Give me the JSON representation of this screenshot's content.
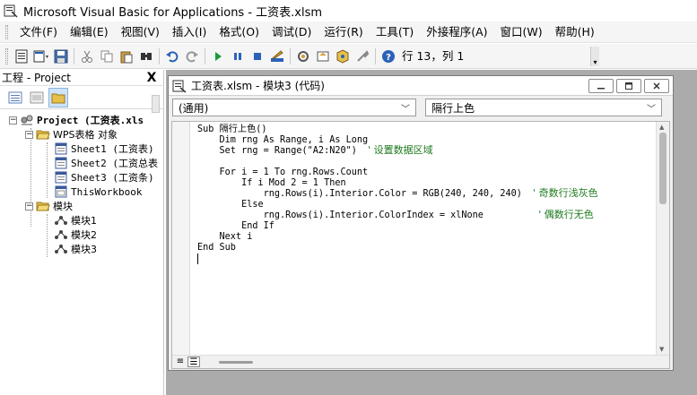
{
  "window": {
    "title": "Microsoft Visual Basic for Applications - 工资表.xlsm"
  },
  "menu": {
    "items": [
      "文件(F)",
      "编辑(E)",
      "视图(V)",
      "插入(I)",
      "格式(O)",
      "调试(D)",
      "运行(R)",
      "工具(T)",
      "外接程序(A)",
      "窗口(W)",
      "帮助(H)"
    ]
  },
  "toolbar": {
    "position": "行 13，列 1",
    "icons": [
      "view-excel-icon",
      "insert-module-icon",
      "save-icon",
      "cut-icon",
      "copy-icon",
      "paste-icon",
      "find-icon",
      "undo-icon",
      "redo-icon",
      "run-icon",
      "break-icon",
      "reset-icon",
      "design-mode-icon",
      "project-explorer-icon",
      "properties-icon",
      "object-browser-icon",
      "toolbox-icon",
      "help-icon"
    ]
  },
  "project": {
    "title": "工程 - Project",
    "close": "X",
    "root": "Project (工资表.xls",
    "folder_objects": "WPS表格 对象",
    "sheets": [
      "Sheet1 (工资表)",
      "Sheet2 (工资总表",
      "Sheet3 (工资条)",
      "ThisWorkbook"
    ],
    "folder_modules": "模块",
    "modules": [
      "模块1",
      "模块2",
      "模块3"
    ]
  },
  "code_window": {
    "title": "工资表.xlsm - 模块3 (代码)",
    "object_combo": "(通用)",
    "proc_combo": "隔行上色",
    "lines": [
      {
        "code": "Sub 隔行上色()",
        "comment": ""
      },
      {
        "code": "    Dim rng As Range, i As Long",
        "comment": ""
      },
      {
        "code": "    Set rng = Range(\"A2:N20\")  ",
        "comment": "' 设置数据区域"
      },
      {
        "code": "",
        "comment": ""
      },
      {
        "code": "    For i = 1 To rng.Rows.Count",
        "comment": ""
      },
      {
        "code": "        If i Mod 2 = 1 Then",
        "comment": ""
      },
      {
        "code": "            rng.Rows(i).Interior.Color = RGB(240, 240, 240)  ",
        "comment": "' 奇数行浅灰色"
      },
      {
        "code": "        Else",
        "comment": ""
      },
      {
        "code": "            rng.Rows(i).Interior.ColorIndex = xlNone          ",
        "comment": "' 偶数行无色"
      },
      {
        "code": "        End If",
        "comment": ""
      },
      {
        "code": "    Next i",
        "comment": ""
      },
      {
        "code": "End Sub",
        "comment": ""
      },
      {
        "code": "",
        "comment": ""
      }
    ]
  },
  "colors": {
    "comment": "#1d7a1d",
    "mdi_background": "#ababab",
    "run_green": "#1a9a3a"
  }
}
